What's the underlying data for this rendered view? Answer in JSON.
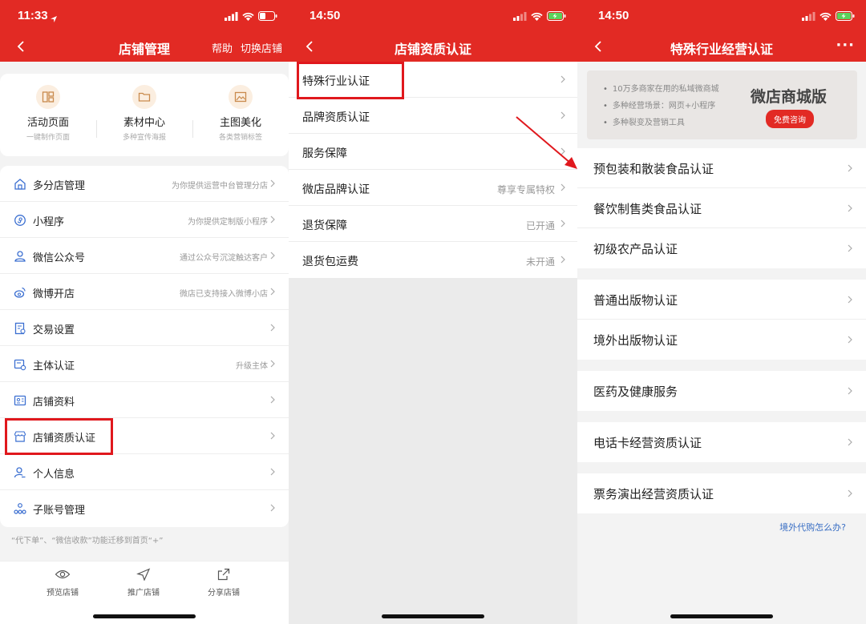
{
  "colors": {
    "brand": "#e22a24",
    "highlight": "#e0181d",
    "link": "#3a6fc4"
  },
  "screen1": {
    "status_time": "11:33",
    "title": "店铺管理",
    "right_actions": [
      "帮助",
      "切换店铺"
    ],
    "quick_actions": [
      {
        "label": "活动页面",
        "sub": "一键制作页面",
        "icon": "layout-icon"
      },
      {
        "label": "素材中心",
        "sub": "多种宣传海报",
        "icon": "folder-icon"
      },
      {
        "label": "主图美化",
        "sub": "各类营销标签",
        "icon": "image-icon"
      }
    ],
    "menu": [
      {
        "label": "多分店管理",
        "hint": "为你提供运营中台管理分店",
        "icon": "home-icon"
      },
      {
        "label": "小程序",
        "hint": "为你提供定制版小程序",
        "icon": "mini-program-icon"
      },
      {
        "label": "微信公众号",
        "hint": "通过公众号沉淀触达客户",
        "icon": "user-icon"
      },
      {
        "label": "微博开店",
        "hint": "微店已支持接入微博小店",
        "icon": "weibo-icon"
      },
      {
        "label": "交易设置",
        "hint": "",
        "icon": "document-icon"
      },
      {
        "label": "主体认证",
        "hint": "升级主体",
        "icon": "verify-icon"
      },
      {
        "label": "店铺资料",
        "hint": "",
        "icon": "id-card-icon"
      },
      {
        "label": "店铺资质认证",
        "hint": "",
        "icon": "store-icon"
      },
      {
        "label": "个人信息",
        "hint": "",
        "icon": "person-icon"
      },
      {
        "label": "子账号管理",
        "hint": "",
        "icon": "org-icon"
      }
    ],
    "note": "“代下单”、“微信收款”功能迁移到首页“+”",
    "tabs": [
      {
        "label": "预览店铺",
        "icon": "eye-icon"
      },
      {
        "label": "推广店铺",
        "icon": "send-icon"
      },
      {
        "label": "分享店铺",
        "icon": "share-icon"
      }
    ]
  },
  "screen2": {
    "status_time": "14:50",
    "title": "店铺资质认证",
    "menu": [
      {
        "label": "特殊行业认证",
        "hint": ""
      },
      {
        "label": "品牌资质认证",
        "hint": ""
      },
      {
        "label": "服务保障",
        "hint": ""
      },
      {
        "label": "微店品牌认证",
        "hint": "尊享专属特权"
      },
      {
        "label": "退货保障",
        "hint": "已开通"
      },
      {
        "label": "退货包运费",
        "hint": "未开通"
      }
    ]
  },
  "screen3": {
    "status_time": "14:50",
    "title": "特殊行业经营认证",
    "more": "···",
    "banner": {
      "bullets": [
        "10万多商家在用的私域微商城",
        "多种经营场景：网页+小程序",
        "多种裂变及营销工具"
      ],
      "headline": "微店商城版",
      "cta": "免费咨询"
    },
    "groups": [
      [
        "预包装和散装食品认证",
        "餐饮制售类食品认证",
        "初级农产品认证"
      ],
      [
        "普通出版物认证",
        "境外出版物认证"
      ],
      [
        "医药及健康服务"
      ],
      [
        "电话卡经营资质认证"
      ],
      [
        "票务演出经营资质认证"
      ]
    ],
    "link": "境外代购怎么办?"
  }
}
